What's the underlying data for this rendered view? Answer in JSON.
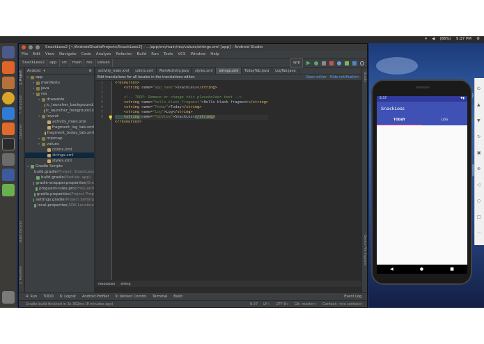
{
  "topbar": {
    "battery": "(86%)",
    "time": "9:37 PM"
  },
  "ide": {
    "title": "SnackLess2 [~/AndroidStudioProjects/SnackLess2] - .../app/src/main/res/values/strings.xml [app] - Android Studio",
    "menu": [
      "File",
      "Edit",
      "View",
      "Navigate",
      "Code",
      "Analyze",
      "Refactor",
      "Build",
      "Run",
      "Tools",
      "VCS",
      "Window",
      "Help"
    ],
    "breadcrumbs": [
      "SnackLess2",
      "app",
      "src",
      "main",
      "res",
      "values"
    ],
    "run_config": "app",
    "project_view": "Android",
    "tree": [
      {
        "label": "app",
        "level": 0,
        "icon": "folder-icon"
      },
      {
        "label": "manifests",
        "level": 1,
        "icon": "folder-icon"
      },
      {
        "label": "java",
        "level": 1,
        "icon": "folder-icon"
      },
      {
        "label": "res",
        "level": 1,
        "icon": "folder-icon"
      },
      {
        "label": "drawable",
        "level": 2,
        "icon": "folder-icon"
      },
      {
        "label": "ic_launcher_background.",
        "level": 3,
        "icon": "file-icon"
      },
      {
        "label": "ic_launcher_foreground.x",
        "level": 3,
        "icon": "file-icon"
      },
      {
        "label": "layout",
        "level": 2,
        "icon": "folder-icon"
      },
      {
        "label": "activity_main.xml",
        "level": 3,
        "icon": "file-icon"
      },
      {
        "label": "fragment_log_tab.xml",
        "level": 3,
        "icon": "file-icon"
      },
      {
        "label": "fragment_today_tab.xml",
        "level": 3,
        "icon": "file-icon"
      },
      {
        "label": "mipmap",
        "level": 2,
        "icon": "folder-icon"
      },
      {
        "label": "values",
        "level": 2,
        "icon": "folder-icon"
      },
      {
        "label": "colors.xml",
        "level": 3,
        "icon": "file-icon"
      },
      {
        "label": "strings.xml",
        "level": 3,
        "icon": "file-icon",
        "selected": true
      },
      {
        "label": "styles.xml",
        "level": 3,
        "icon": "file-icon"
      },
      {
        "label": "Gradle Scripts",
        "level": 0,
        "icon": "gradle-icon"
      },
      {
        "label": "build.gradle",
        "suffix": " (Project: SnackLess",
        "level": 1,
        "icon": "gradle-icon"
      },
      {
        "label": "build.gradle",
        "suffix": " (Module: app)",
        "level": 1,
        "icon": "gradle-icon"
      },
      {
        "label": "gradle-wrapper.properties",
        "suffix": " (Gra",
        "level": 1,
        "icon": "gradle-icon"
      },
      {
        "label": "proguard-rules.pro",
        "suffix": " (ProGuard",
        "level": 1,
        "icon": "gradle-icon"
      },
      {
        "label": "gradle.properties",
        "suffix": " (Project Prop",
        "level": 1,
        "icon": "gradle-icon"
      },
      {
        "label": "settings.gradle",
        "suffix": " (Project Setting",
        "level": 1,
        "icon": "gradle-icon"
      },
      {
        "label": "local.properties",
        "suffix": " (SDK Location",
        "level": 1,
        "icon": "gradle-icon"
      }
    ],
    "tabs": [
      "activity_main.xml",
      "colors.xml",
      "MainActivity.java",
      "styles.xml",
      "strings.xml",
      "TodayTab.java",
      "LogTab.java"
    ],
    "active_tab": "strings.xml",
    "banner": {
      "text": "Edit translations for all locales in the translations editor.",
      "open_editor": "Open editor",
      "hide": "Hide notification"
    },
    "line_numbers": [
      "1",
      "2",
      "3",
      "4",
      "5",
      "6",
      "7",
      "8"
    ],
    "code": [
      [
        {
          "t": "<resources>",
          "c": "tg"
        }
      ],
      [
        {
          "t": "    <string ",
          "c": "tg"
        },
        {
          "t": "name=",
          "c": "at"
        },
        {
          "t": "\"app_name\"",
          "c": "vl"
        },
        {
          "t": ">",
          "c": "tg"
        },
        {
          "t": "SnackLess",
          "c": "tx"
        },
        {
          "t": "</string>",
          "c": "tg"
        }
      ],
      [],
      [
        {
          "t": "    <!-- TODO: Remove or change this placeholder text -->",
          "c": "cm"
        }
      ],
      [
        {
          "t": "    <string ",
          "c": "tg"
        },
        {
          "t": "name=",
          "c": "at"
        },
        {
          "t": "\"hello_blank_fragment\"",
          "c": "vl"
        },
        {
          "t": ">",
          "c": "tg"
        },
        {
          "t": "Hello blank fragment",
          "c": "tx"
        },
        {
          "t": "</string>",
          "c": "tg"
        }
      ],
      [
        {
          "t": "    <string ",
          "c": "tg"
        },
        {
          "t": "name=",
          "c": "at"
        },
        {
          "t": "\"Today\"",
          "c": "vl"
        },
        {
          "t": ">",
          "c": "tg"
        },
        {
          "t": "Today",
          "c": "tx"
        },
        {
          "t": "</string>",
          "c": "tg"
        }
      ],
      [
        {
          "t": "    <string ",
          "c": "tg"
        },
        {
          "t": "name=",
          "c": "at"
        },
        {
          "t": "\"Log\"",
          "c": "vl"
        },
        {
          "t": ">",
          "c": "tg"
        },
        {
          "t": "Log",
          "c": "tx"
        },
        {
          "t": "</string>",
          "c": "tg"
        }
      ],
      [
        {
          "t": "    <string ",
          "c": "tg hl"
        },
        {
          "t": "name=",
          "c": "at"
        },
        {
          "t": "\"TabView\"",
          "c": "vl"
        },
        {
          "t": ">",
          "c": "tg"
        },
        {
          "t": "SnackLess",
          "c": "tx"
        },
        {
          "t": "</string>",
          "c": "tg hl"
        }
      ],
      [
        {
          "t": "</resources>",
          "c": "tg"
        }
      ]
    ],
    "editor_footer": [
      "resources",
      "string"
    ],
    "bottom_tools": [
      "4: Run",
      "TODO",
      "6: Logcat",
      "Android Profiler",
      "9: Version Control",
      "Terminal",
      "Build"
    ],
    "event_log": "Event Log",
    "status_left": "Gradle build finished in 3s 362ms (8 minutes ago)",
    "status_right": [
      "8:37",
      "LF÷",
      "UTF-8÷",
      "Git: master÷",
      "Context: <no context>"
    ],
    "left_tool_tabs": [
      "1: Project",
      "7: Structure",
      "Captures",
      "Build Variants",
      "2: Favorites"
    ],
    "right_tool_tabs": [
      "Gradle",
      "Device File Explorer"
    ]
  },
  "phone": {
    "status_time": "5:37",
    "status_right": "▼▮",
    "app_title": "SnackLess",
    "tabs": [
      "TODAY",
      "LOG"
    ],
    "nav": [
      "◀",
      "●",
      "■"
    ]
  },
  "colors": {
    "accent": "#3f51b5",
    "tab_indicator": "#ff4081"
  }
}
